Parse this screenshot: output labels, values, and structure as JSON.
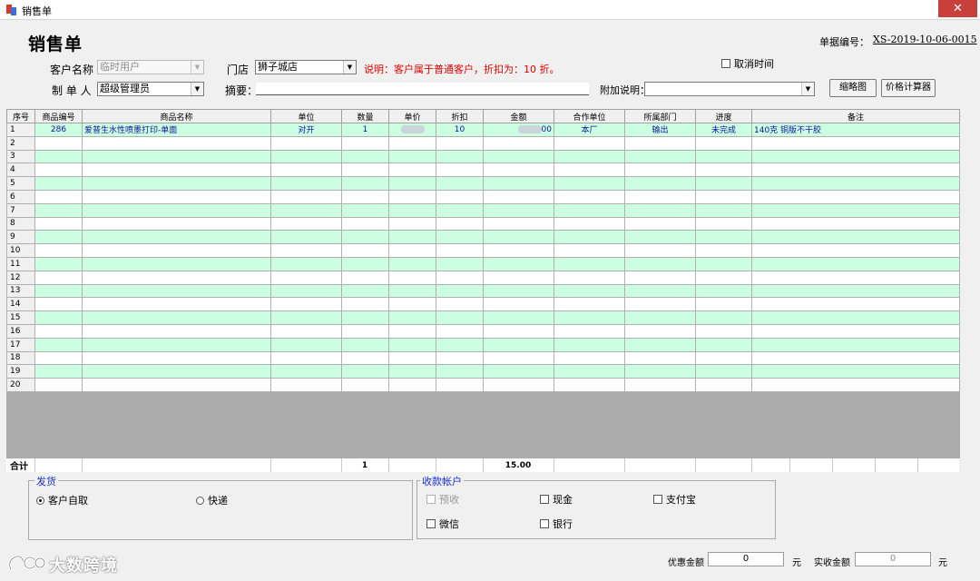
{
  "window": {
    "title": "销售单",
    "close": "✕"
  },
  "header": {
    "title": "销售单",
    "doc_no_label": "单据编号：",
    "doc_no": "XS-2019-10-06-0015"
  },
  "form": {
    "customer_label": "客户名称",
    "customer_value": "临时用户",
    "store_label": "门店",
    "store_value": "狮子城店",
    "note": "说明：客户属于普通客户，折扣为：10 折。",
    "cancel_time_label": "取消时间",
    "creator_label": "制 单 人",
    "creator_value": "超级管理员",
    "summary_label": "摘要：",
    "summary_value": "",
    "extra_label": "附加说明：",
    "extra_value": "",
    "thumbnail_btn": "缩略图",
    "calc_btn": "价格计算器"
  },
  "table": {
    "columns": [
      "序号",
      "商品编号",
      "商品名称",
      "单位",
      "数量",
      "单价",
      "折扣",
      "金额",
      "合作单位",
      "所属部门",
      "进度",
      "备注"
    ],
    "rows": [
      {
        "no": "1",
        "code": "286",
        "name": "爱普生水性喷墨打印-单面",
        "unit": "对开",
        "qty": "1",
        "price": "",
        "discount": "10",
        "amount": "00",
        "partner": "本厂",
        "dept": "输出",
        "progress": "未完成",
        "remark": "140克 铜版不干胶"
      },
      {
        "no": "2"
      },
      {
        "no": "3"
      },
      {
        "no": "4"
      },
      {
        "no": "5"
      },
      {
        "no": "6"
      },
      {
        "no": "7"
      },
      {
        "no": "8"
      },
      {
        "no": "9"
      },
      {
        "no": "10"
      },
      {
        "no": "11"
      },
      {
        "no": "12"
      },
      {
        "no": "13"
      },
      {
        "no": "14"
      },
      {
        "no": "15"
      },
      {
        "no": "16"
      },
      {
        "no": "17"
      },
      {
        "no": "18"
      },
      {
        "no": "19"
      },
      {
        "no": "20"
      }
    ]
  },
  "totals": {
    "label": "合计",
    "qty": "1",
    "amount": "15.00"
  },
  "delivery": {
    "title": "发货",
    "options": [
      {
        "label": "客户自取",
        "selected": true
      },
      {
        "label": "快递",
        "selected": false
      }
    ]
  },
  "accounts": {
    "title": "收款帐户",
    "items": [
      {
        "label": "预收",
        "disabled": true
      },
      {
        "label": "现金",
        "disabled": false
      },
      {
        "label": "支付宝",
        "disabled": false
      },
      {
        "label": "微信",
        "disabled": false
      },
      {
        "label": "银行",
        "disabled": false
      }
    ]
  },
  "footer": {
    "discount_label": "优惠金额",
    "discount_value": "0",
    "received_label": "实收金额",
    "received_value": "0",
    "unit": "元"
  },
  "watermark": {
    "text": "大数跨境"
  },
  "colors": {
    "row_alt": "#ccffe2",
    "note": "#e00000",
    "group_title": "#1a30c8",
    "close": "#c7403a"
  }
}
